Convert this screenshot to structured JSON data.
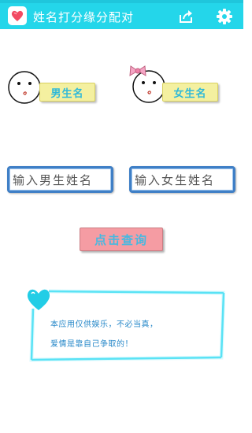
{
  "header": {
    "title": "姓名打分缘分配对",
    "icons": [
      "heart-app-icon",
      "share-icon",
      "gear-icon"
    ],
    "background": "#24d6ea"
  },
  "male": {
    "tag_label": "男生名",
    "input_placeholder": "输入男生姓名"
  },
  "female": {
    "tag_label": "女生名",
    "input_placeholder": "输入女生姓名"
  },
  "query_button": {
    "label": "点击查询",
    "color": "#f59ca3"
  },
  "note": {
    "line1": "本应用仅供娱乐，不必当真，",
    "line2": "爱情是靠自己争取的！",
    "frame_color": "#20d8f0"
  }
}
